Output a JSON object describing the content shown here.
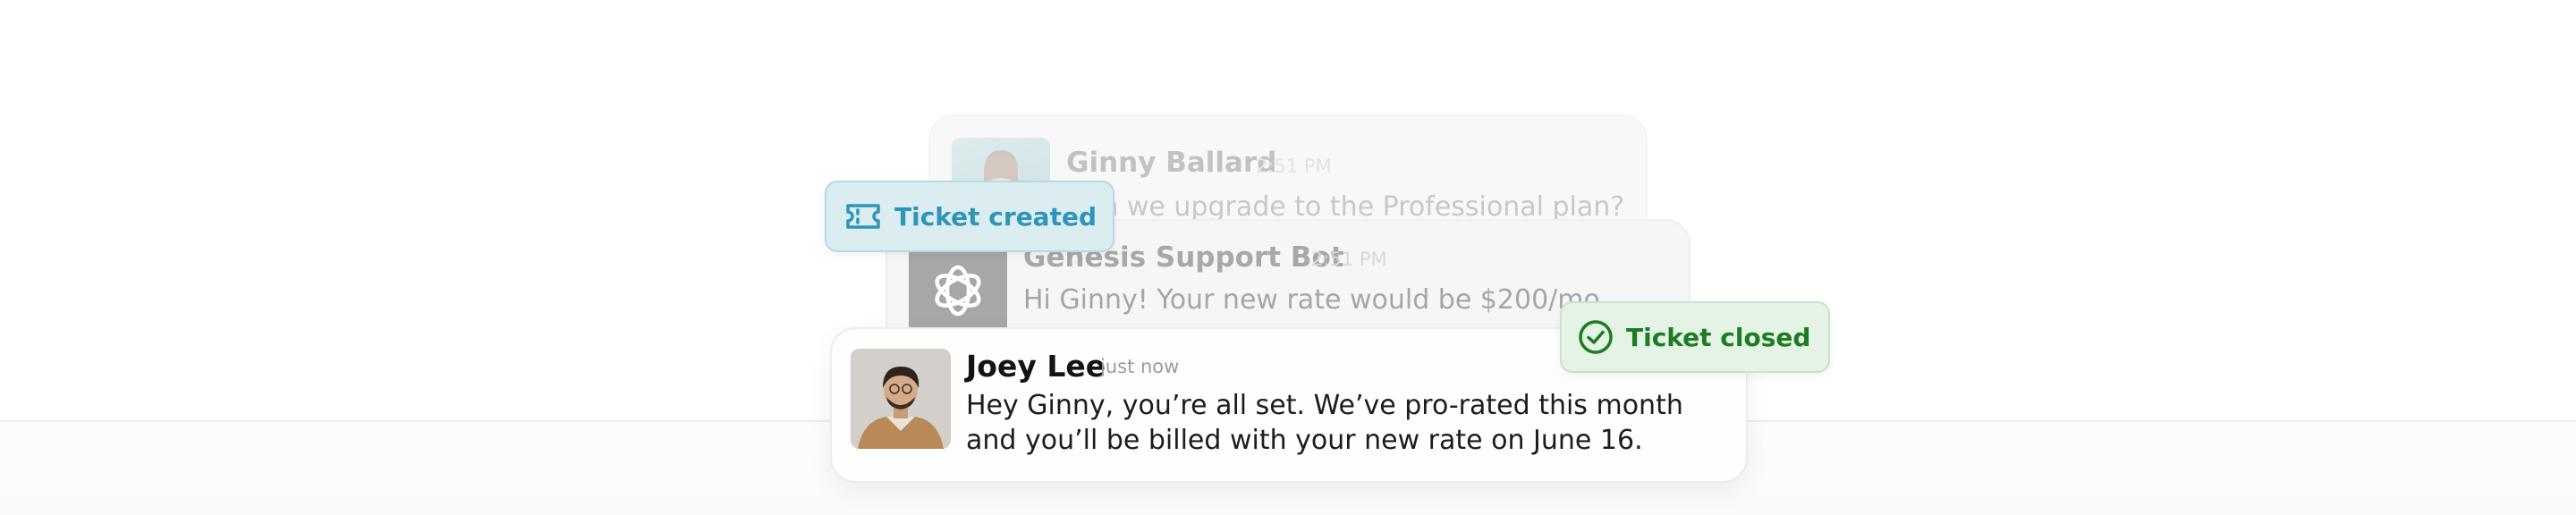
{
  "colors": {
    "ticket_created": "#2f95b8",
    "ticket_closed": "#1c7d22",
    "primary_text": "#141414"
  },
  "messages": [
    {
      "name": "Ginny Ballard",
      "time": "2:51 PM",
      "text": "Can we upgrade to the Professional plan?",
      "avatar": "person-photo"
    },
    {
      "name": "Genesis Support Bot",
      "time": "2:51 PM",
      "text": "Hi Ginny! Your new rate would be $200/mo.",
      "avatar": "bot-logo-icon"
    },
    {
      "name": "Joey Lee",
      "time": "just now",
      "text": "Hey Ginny, you’re all set. We’ve pro-rated this month and you’ll be billed with your new rate on June 16.",
      "avatar": "person-photo"
    }
  ],
  "badges": {
    "created": {
      "label": "Ticket created",
      "icon": "ticket-icon"
    },
    "closed": {
      "label": "Ticket closed",
      "icon": "check-circle-icon"
    }
  }
}
